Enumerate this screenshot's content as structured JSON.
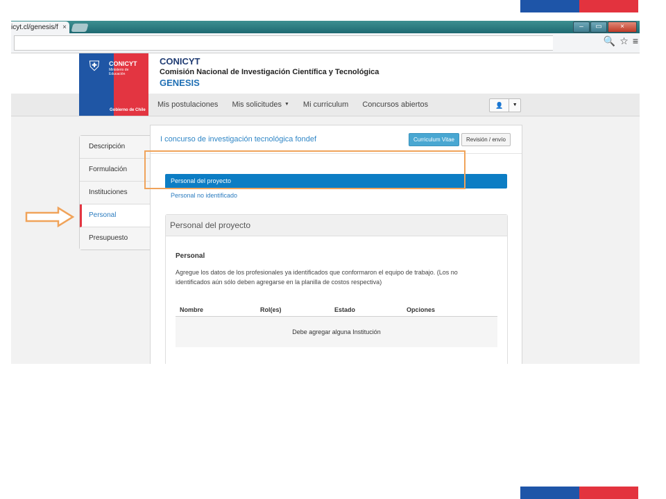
{
  "browser": {
    "tab_title": "icyt.cl/genesis/f",
    "tab_close": "×",
    "icons": [
      "search-icon",
      "star-icon",
      "menu-icon"
    ],
    "window_controls": [
      "minimize",
      "maximize",
      "close"
    ]
  },
  "header": {
    "logo_name": "CONICYT",
    "logo_ministry": "Ministerio de Educación",
    "logo_government": "Gobierno de Chile",
    "org_short": "CONICYT",
    "org_full": "Comisión Nacional de Investigación Científica y Tecnológica",
    "system_name": "GENESIS"
  },
  "navbar": {
    "items": [
      {
        "label": "Mis postulaciones",
        "dropdown": false
      },
      {
        "label": "Mis solicitudes",
        "dropdown": true
      },
      {
        "label": "Mi curriculum",
        "dropdown": false
      },
      {
        "label": "Concursos abiertos",
        "dropdown": false
      }
    ],
    "user_icon": "user-icon"
  },
  "sidebar": {
    "items": [
      {
        "label": "Descripción",
        "active": false
      },
      {
        "label": "Formulación",
        "active": false
      },
      {
        "label": "Instituciones",
        "active": false
      },
      {
        "label": "Personal",
        "active": true
      },
      {
        "label": "Presupuesto",
        "active": false
      }
    ]
  },
  "main": {
    "contest_title": "I concurso de investigación tecnológica fondef",
    "btn_cv": "Curriculum Vitae",
    "btn_review": "Revisión / envío",
    "subnav": [
      {
        "label": "Personal del proyecto",
        "active": true
      },
      {
        "label": "Personal no identificado",
        "active": false
      }
    ],
    "panel_title": "Personal del proyecto",
    "section_title": "Personal",
    "section_desc": "Agregue los datos de los profesionales ya identificados que conformaron el equipo de trabajo. (Los no identificados aún sólo deben agregarse en la planilla de costos respectiva)",
    "table_headers": [
      "Nombre",
      "Rol(es)",
      "Estado",
      "Opciones"
    ],
    "table_empty": "Debe agregar alguna Institución"
  },
  "colors": {
    "flag_blue": "#1e55a8",
    "flag_red": "#e33541",
    "accent": "#0c7dc4",
    "annotation": "#f0a35a"
  }
}
